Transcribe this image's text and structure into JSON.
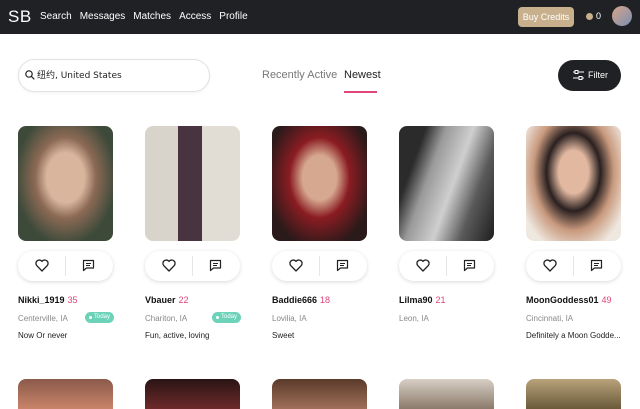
{
  "header": {
    "logo": "SB",
    "nav": [
      "Search",
      "Messages",
      "Matches",
      "Access",
      "Profile"
    ],
    "buy_credits": "Buy Credits",
    "credits": "0"
  },
  "search": {
    "value": "纽约, United States"
  },
  "tabs": {
    "recent": "Recently Active",
    "newest": "Newest"
  },
  "filter_label": "Filter",
  "profiles": [
    {
      "name": "Nikki_1919",
      "age": "35",
      "location": "Centerville, IA",
      "badge": "Today",
      "tagline": "Now Or never"
    },
    {
      "name": "Vbauer",
      "age": "22",
      "location": "Chariton, IA",
      "badge": "Today",
      "tagline": "Fun, active, loving"
    },
    {
      "name": "Baddie666",
      "age": "18",
      "location": "Lovilia, IA",
      "badge": "",
      "tagline": "Sweet"
    },
    {
      "name": "Lilma90",
      "age": "21",
      "location": "Leon, IA",
      "badge": "",
      "tagline": ""
    },
    {
      "name": "MoonGoddess01",
      "age": "49",
      "location": "Cincinnati, IA",
      "badge": "",
      "tagline": "Definitely a Moon Godde..."
    }
  ],
  "colors": {
    "topbar": "#1f2124",
    "accent": "#e0457b",
    "gold": "#c8b08c",
    "online": "#6cd3b8"
  }
}
